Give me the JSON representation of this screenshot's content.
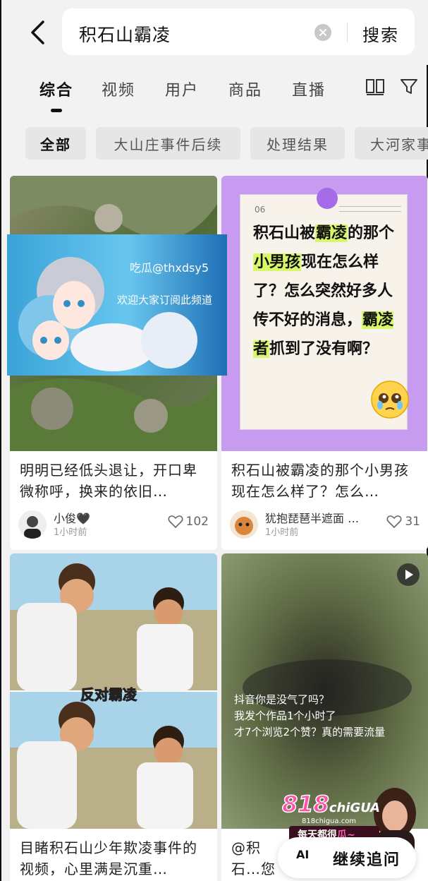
{
  "search": {
    "query": "积石山霸凌",
    "button_label": "搜索"
  },
  "tabs": [
    {
      "label": "综合",
      "active": true
    },
    {
      "label": "视频"
    },
    {
      "label": "用户"
    },
    {
      "label": "商品"
    },
    {
      "label": "直播"
    }
  ],
  "filter_chips": [
    {
      "label": "全部",
      "active": true
    },
    {
      "label": "大山庄事件后续"
    },
    {
      "label": "处理结果"
    },
    {
      "label": "大河家事"
    }
  ],
  "feed": [
    {
      "title": "明明已经低头退让，开口卑微称呼，换来的依旧…",
      "author": "小俊🖤",
      "time": "1小时前",
      "likes": "102",
      "overlay_ad": {
        "line1": "吃瓜@thxdsy5",
        "line2": "欢迎大家订阅此频道"
      }
    },
    {
      "title": "积石山被霸凌的那个小男孩现在怎么样了？怎么…",
      "author": "犹抱琵琶半遮面 …",
      "time": "1小时前",
      "likes": "31",
      "graphic": {
        "num": "06",
        "text_parts": [
          {
            "t": "积石山被"
          },
          {
            "t": "霸凌",
            "hl": true
          },
          {
            "t": "的那个"
          },
          {
            "t": "小男孩",
            "hl": true
          },
          {
            "t": "现在怎么样了？怎么突然好多人传不好的消息，"
          },
          {
            "t": "霸凌者",
            "hl": true
          },
          {
            "t": "抓到了没有啊？"
          }
        ]
      }
    },
    {
      "title": "目睹积石山少年欺凌事件的视频，心里满是沉重…",
      "caption": "反对霸凌"
    },
    {
      "title": "@积石…您好，",
      "video_text": [
        "抖音你是没气了吗？",
        "我发个作品1个小时了",
        "才7个浏览2个赞？真的需要流量"
      ]
    }
  ],
  "promo": {
    "brand": "818",
    "brand_suffix": "chiGUA",
    "site": "818chigua.com",
    "slogan_prefix": "每天都很",
    "slogan_emph": "瓜~"
  },
  "continue_button": {
    "ai_label": "AI",
    "label": "继续追问"
  },
  "colors": {
    "accent_purple": "#c79bf0",
    "highlight": "#d9f76a",
    "promo_pink": "#ff4fa8"
  }
}
